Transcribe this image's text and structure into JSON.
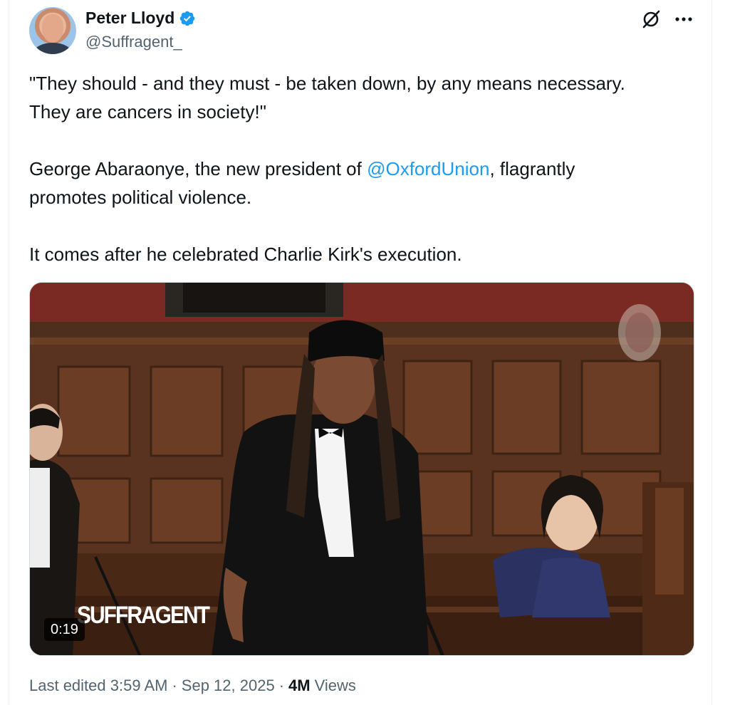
{
  "author": {
    "display_name": "Peter Lloyd",
    "handle": "@Suffragent_",
    "avatar_icon": "profile-photo",
    "verified_icon": "verified-badge-icon"
  },
  "header_actions": {
    "grok_icon": "grok-icon",
    "more_icon": "more-horizontal-icon"
  },
  "tweet": {
    "line1": "\"They should - and they must - be taken down, by any means necessary.",
    "line2": "They are cancers in society!\"",
    "para2_before": "George Abaraonye, the new president of ",
    "para2_mention": "@OxfordUnion",
    "para2_after": ", flagrantly",
    "para2_line2": "promotes political violence.",
    "para3": "It comes after he celebrated Charlie Kirk's execution."
  },
  "media": {
    "watermark": "SUFFRAGENT",
    "duration": "0:19"
  },
  "meta": {
    "edited": "Last edited 3:59 AM",
    "dot": "·",
    "date": "Sep 12, 2025",
    "views_count": "4M",
    "views_label": "Views"
  },
  "colors": {
    "link": "#1d9bf0",
    "secondary_text": "#536471",
    "primary_text": "#0f1419",
    "verified": "#1d9bf0"
  }
}
